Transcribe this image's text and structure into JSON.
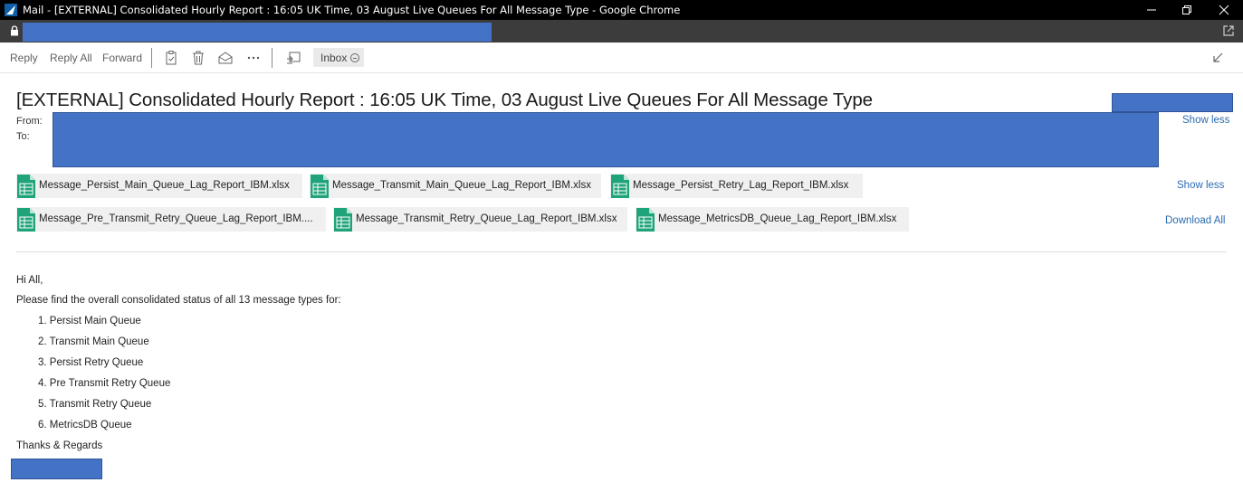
{
  "window": {
    "title": "Mail - [EXTERNAL] Consolidated Hourly Report : 16:05 UK Time, 03 August Live Queues For All Message Type - Google Chrome",
    "minimize_icon": "minimize-icon",
    "restore_icon": "restore-icon",
    "close_icon": "close-icon"
  },
  "toolbar": {
    "reply": "Reply",
    "reply_all": "Reply All",
    "forward": "Forward",
    "inbox_chip": "Inbox",
    "icons": [
      "clipboard-icon",
      "delete-icon",
      "mark-read-icon",
      "more-icon",
      "move-icon",
      "collapse-icon"
    ]
  },
  "message": {
    "subject": "[EXTERNAL] Consolidated Hourly Report : 16:05 UK Time, 03 August Live Queues For All Message Type",
    "from_label": "From:",
    "to_label": "To:",
    "show_less_header": "Show less",
    "show_less_attachments": "Show less",
    "download_all": "Download All"
  },
  "attachments": [
    {
      "name": "Message_Persist_Main_Queue_Lag_Report_IBM.xlsx"
    },
    {
      "name": "Message_Transmit_Main_Queue_Lag_Report_IBM.xlsx"
    },
    {
      "name": "Message_Persist_Retry_Lag_Report_IBM.xlsx"
    },
    {
      "name": "Message_Pre_Transmit_Retry_Queue_Lag_Report_IBM...."
    },
    {
      "name": "Message_Transmit_Retry_Queue_Lag_Report_IBM.xlsx"
    },
    {
      "name": "Message_MetricsDB_Queue_Lag_Report_IBM.xlsx"
    }
  ],
  "body": {
    "greeting": "Hi All,",
    "intro": "Please find the overall consolidated status of all 13 message types for:",
    "list": [
      "1. Persist Main Queue",
      "2. Transmit Main Queue",
      "3. Persist Retry Queue",
      "4. Pre Transmit Retry Queue",
      "5. Transmit Retry Queue",
      "6. MetricsDB Queue"
    ],
    "closing": "Thanks & Regards"
  },
  "colors": {
    "redaction": "#4472c4",
    "link": "#2b6cb0",
    "excel": "#21a366"
  }
}
